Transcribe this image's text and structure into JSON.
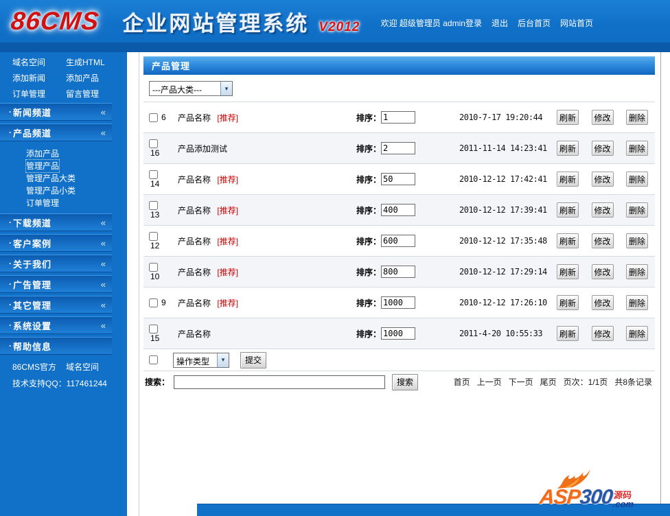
{
  "header": {
    "logo": "86CMS",
    "title": "企业网站管理系统",
    "version": "V2012",
    "welcome": "欢迎 超级管理员 admin登录",
    "links": [
      "退出",
      "后台首页",
      "网站首页"
    ]
  },
  "sidebar": {
    "bullet": "·",
    "quick_links": [
      "域名空间",
      "生成HTML",
      "添加新闻",
      "添加产品",
      "订单管理",
      "留言管理"
    ],
    "sections": [
      {
        "label": "新闻频道",
        "icon": "«"
      },
      {
        "label": "产品频道",
        "icon": "«"
      },
      {
        "label": "下载频道",
        "icon": "«"
      },
      {
        "label": "客户案例",
        "icon": "«"
      },
      {
        "label": "关于我们",
        "icon": "«"
      },
      {
        "label": "广告管理",
        "icon": "«"
      },
      {
        "label": "其它管理",
        "icon": "«"
      },
      {
        "label": "系统设置",
        "icon": "«"
      },
      {
        "label": "帮助信息",
        "icon": ""
      }
    ],
    "product_submenu": [
      "添加产品",
      "管理产品",
      "管理产品大类",
      "管理产品小类",
      "订单管理"
    ],
    "active_submenu": "管理产品",
    "footer_links": [
      "86CMS官方",
      "域名空间"
    ],
    "support": "技术支持QQ：117461244"
  },
  "main": {
    "title": "产品管理",
    "category_select": "---产品大类---",
    "dropdown_arrow": "▼",
    "sort_label": "排序：",
    "row_buttons": {
      "refresh": "刷新",
      "modify": "修改",
      "delete": "删除"
    },
    "rows": [
      {
        "id": "6",
        "name": "产品名称",
        "tag": "[推荐]",
        "sort": "1",
        "date": "2010-7-17 19:20:44"
      },
      {
        "id": "16",
        "name": "产品添加测试",
        "tag": "",
        "sort": "2",
        "date": "2011-11-14 14:23:41"
      },
      {
        "id": "14",
        "name": "产品名称",
        "tag": "[推荐]",
        "sort": "50",
        "date": "2010-12-12 17:42:41"
      },
      {
        "id": "13",
        "name": "产品名称",
        "tag": "[推荐]",
        "sort": "400",
        "date": "2010-12-12 17:39:41"
      },
      {
        "id": "12",
        "name": "产品名称",
        "tag": "[推荐]",
        "sort": "600",
        "date": "2010-12-12 17:35:48"
      },
      {
        "id": "10",
        "name": "产品名称",
        "tag": "[推荐]",
        "sort": "800",
        "date": "2010-12-12 17:29:14"
      },
      {
        "id": "9",
        "name": "产品名称",
        "tag": "[推荐]",
        "sort": "1000",
        "date": "2010-12-12 17:26:10"
      },
      {
        "id": "15",
        "name": "产品名称",
        "tag": "",
        "sort": "1000",
        "date": "2011-4-20 10:55:33"
      }
    ],
    "batch": {
      "select": "操作类型",
      "submit": "提交"
    },
    "search": {
      "label": "搜索：",
      "value": "",
      "button": "搜索"
    },
    "pagination": {
      "first": "首页",
      "prev": "上一页",
      "next": "下一页",
      "last": "尾页",
      "page_info": "页次：1/1页",
      "total": "共8条记录"
    }
  },
  "watermark": {
    "brand": "ASP",
    "number": "300",
    "domain": ".com",
    "tag": "源码"
  },
  "colors": {
    "header_blue": "#1171c9",
    "dark_band_blue": "#0b5aa9",
    "panel_gradient_top": "#55aaea",
    "panel_gradient_bottom": "#1166c0",
    "accent_red": "#cc0000",
    "row_alt": "#f3f5f9"
  }
}
